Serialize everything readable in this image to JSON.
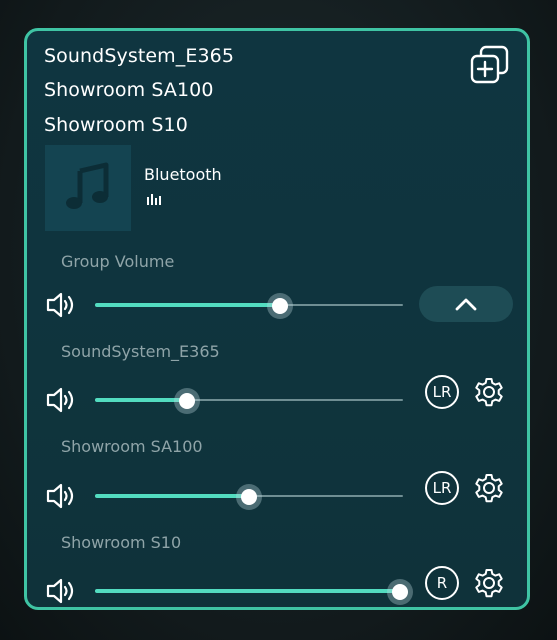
{
  "group": {
    "devices": [
      "SoundSystem_E365",
      "Showroom SA100",
      "Showroom S10"
    ],
    "add_icon": "add-group-icon"
  },
  "now_playing": {
    "source": "Bluetooth",
    "art_icon": "music-note-icon",
    "eq_icon": "equalizer-icon"
  },
  "group_volume": {
    "label": "Group Volume",
    "level": 0.6,
    "collapse_icon": "chevron-up-icon"
  },
  "speakers": [
    {
      "label": "SoundSystem_E365",
      "level": 0.3,
      "channel": "LR"
    },
    {
      "label": "Showroom SA100",
      "level": 0.5,
      "channel": "LR"
    },
    {
      "label": "Showroom S10",
      "level": 0.99,
      "channel": "R"
    }
  ],
  "colors": {
    "accent": "#3fc4a4",
    "slider_fill": "#53dcc0",
    "card_bg": "#0f3540"
  }
}
